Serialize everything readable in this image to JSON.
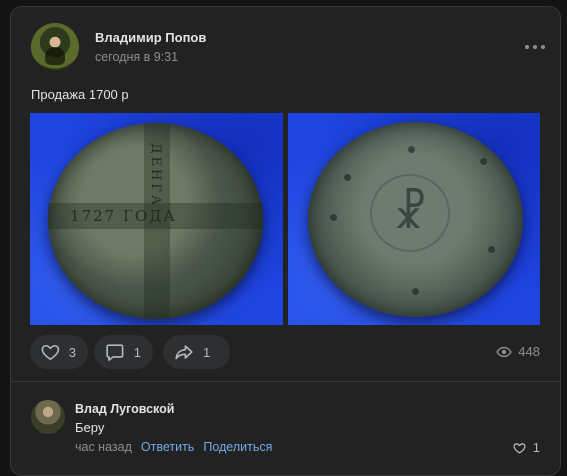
{
  "post": {
    "author": "Владимир Попов",
    "time": "сегодня в 9:31",
    "text": "Продажа 1700 р",
    "photos": [
      {
        "alt": "coin-obverse",
        "inscription_h": "1727 ГОДА",
        "inscription_v": "ДЕНГА"
      },
      {
        "alt": "coin-reverse"
      }
    ],
    "actions": {
      "likes": "3",
      "comments": "1",
      "shares": "1",
      "views": "448"
    }
  },
  "comment": {
    "author": "Влад Луговской",
    "text": "Беру",
    "time": "час назад",
    "reply_label": "Ответить",
    "share_label": "Поделиться",
    "likes": "1"
  },
  "colors": {
    "background": "#141414",
    "card": "#222222",
    "link": "#71aaeb",
    "photo_backdrop": "#1f45e0"
  },
  "icons": [
    "more-icon",
    "heart-icon",
    "comment-icon",
    "share-icon",
    "eye-icon"
  ]
}
